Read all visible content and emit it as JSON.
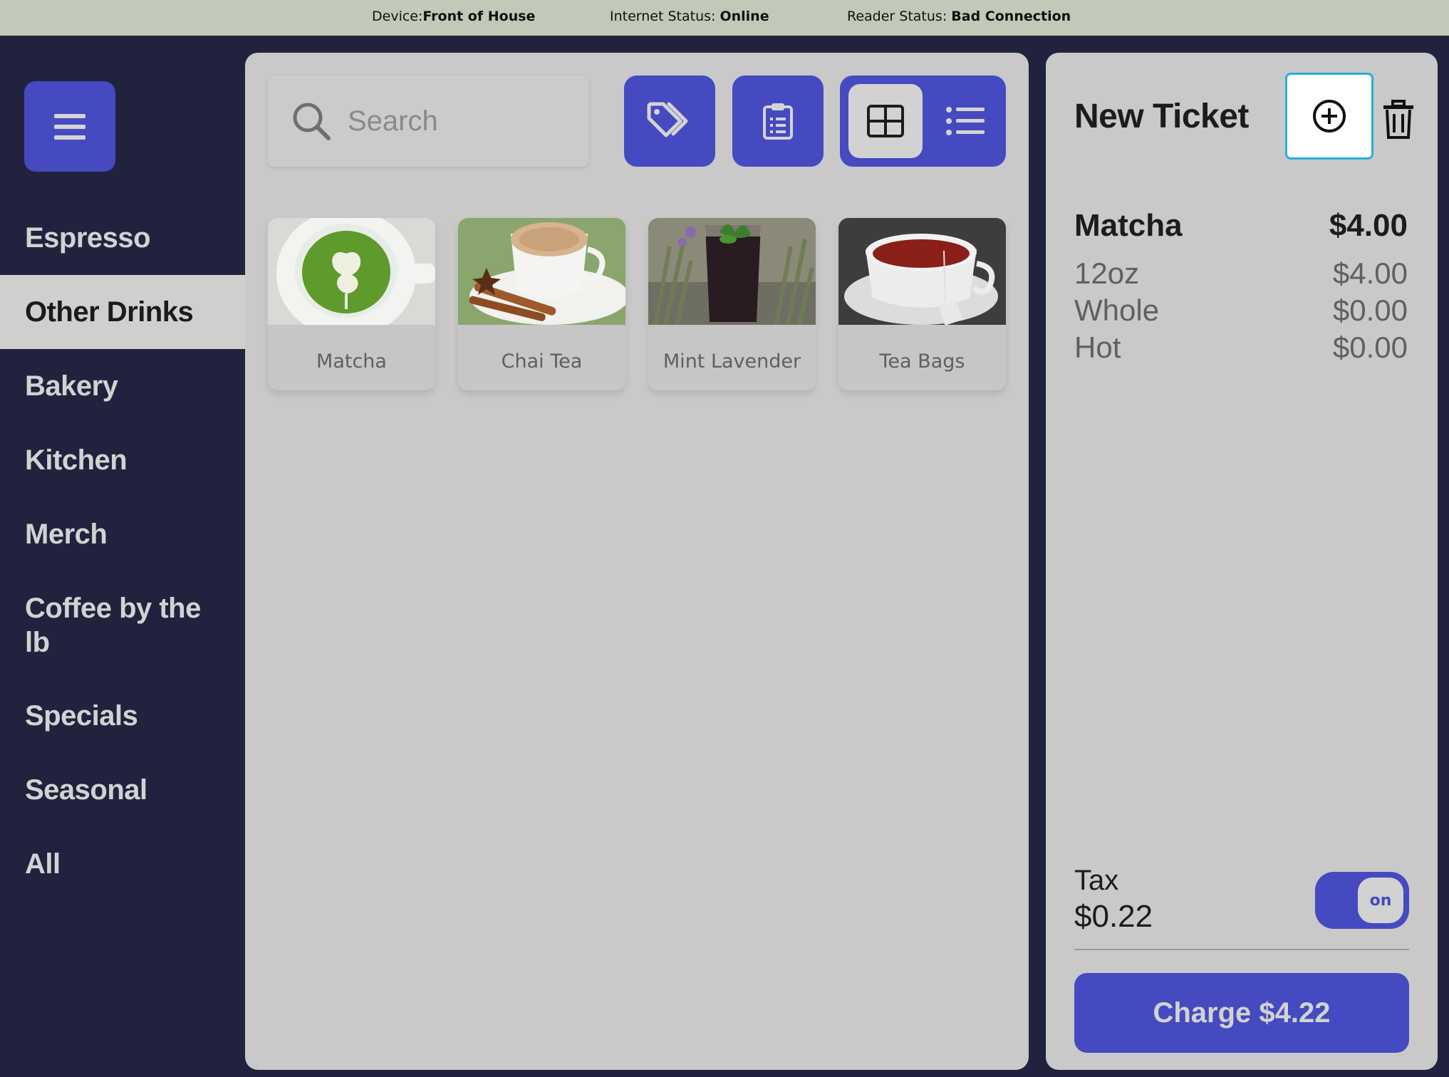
{
  "status_bar": {
    "device_label": "Device:",
    "device_value": "Front of House",
    "internet_label": "Internet Status: ",
    "internet_value": "Online",
    "reader_label": "Reader Status: ",
    "reader_value": "Bad Connection"
  },
  "sidebar": {
    "menu_icon": "hamburger-icon",
    "categories": [
      {
        "label": "Espresso"
      },
      {
        "label": "Other Drinks",
        "active": true
      },
      {
        "label": "Bakery"
      },
      {
        "label": "Kitchen"
      },
      {
        "label": "Merch"
      },
      {
        "label": "Coffee by the lb"
      },
      {
        "label": "Specials"
      },
      {
        "label": "Seasonal"
      },
      {
        "label": "All"
      }
    ]
  },
  "toolbar": {
    "search_placeholder": "Search",
    "buttons": [
      "tag-icon",
      "clipboard-icon"
    ],
    "view_modes": [
      "grid-icon",
      "list-icon"
    ],
    "active_view": "grid"
  },
  "products": [
    {
      "name": "Matcha"
    },
    {
      "name": "Chai Tea"
    },
    {
      "name": "Mint Lavender"
    },
    {
      "name": "Tea Bags"
    }
  ],
  "ticket": {
    "title": "New Ticket",
    "items": [
      {
        "name": "Matcha",
        "price": "$4.00",
        "modifiers": [
          {
            "name": "12oz",
            "price": "$4.00"
          },
          {
            "name": "Whole",
            "price": "$0.00"
          },
          {
            "name": "Hot",
            "price": "$0.00"
          }
        ]
      }
    ],
    "tax_label": "Tax",
    "tax_value": "$0.22",
    "tax_toggle": "on",
    "charge_label": "Charge $4.22"
  },
  "colors": {
    "accent": "#454ac0",
    "sidebar_bg": "#20223e",
    "panel_bg": "#c9c9c9",
    "status_bar_bg": "#c2c9b9",
    "focus_ring": "#29aee0"
  }
}
